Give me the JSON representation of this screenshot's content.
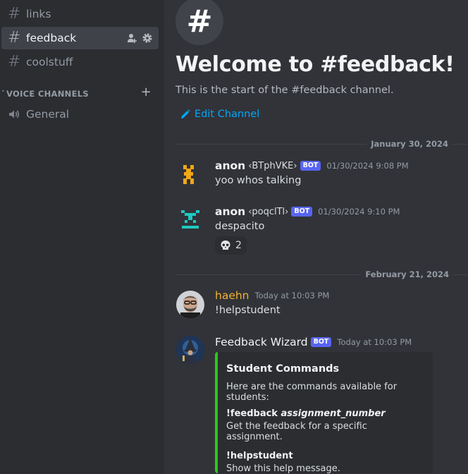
{
  "sidebar": {
    "channels": [
      {
        "label": "links",
        "active": false
      },
      {
        "label": "feedback",
        "active": true
      },
      {
        "label": "coolstuff",
        "active": false
      }
    ],
    "voice_category": "VOICE CHANNELS",
    "voice_channels": [
      {
        "label": "General"
      }
    ]
  },
  "main": {
    "welcome_title": "Welcome to #feedback!",
    "welcome_sub": "This is the start of the #feedback channel.",
    "edit_channel": "Edit Channel",
    "dividers": [
      "January 30, 2024",
      "February 21, 2024"
    ],
    "messages": [
      {
        "user": "anon",
        "tag": "‹BTphVKE›",
        "bot": "BOT",
        "time": "01/30/2024 9:08 PM",
        "text": "yoo whos talking"
      },
      {
        "user": "anon",
        "tag": "‹poqclTl›",
        "bot": "BOT",
        "time": "01/30/2024 9:10 PM",
        "text": "despacito",
        "reaction": {
          "emoji": "skull-icon",
          "count": "2"
        }
      },
      {
        "user": "haehn",
        "time": "Today at 10:03 PM",
        "text": "!helpstudent",
        "name_color": "#f0b232"
      },
      {
        "user": "Feedback Wizard",
        "bot": "BOT",
        "time": "Today at 10:03 PM"
      }
    ],
    "embed": {
      "title": "Student Commands",
      "description": "Here are the commands available for students:",
      "fields": [
        {
          "command": "!feedback",
          "arg": "assignment_number",
          "value": "Get the feedback for a specific assignment."
        },
        {
          "command": "!helpstudent",
          "arg": "",
          "value": "Show this help message."
        }
      ],
      "accent": "#2ec716"
    }
  },
  "colors": {
    "background": "#313338",
    "sidebar": "#2b2d31",
    "link": "#00a8fc",
    "bot_badge": "#5865f2"
  }
}
